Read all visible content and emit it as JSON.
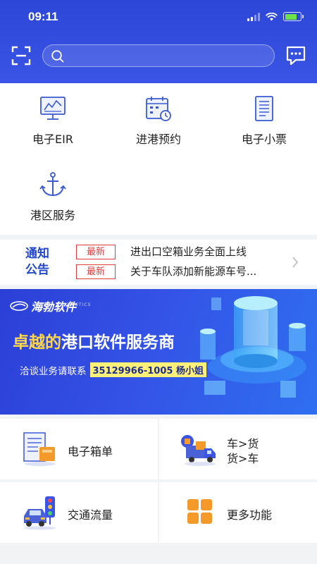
{
  "status_bar": {
    "time": "09:11"
  },
  "search": {
    "placeholder": "",
    "value": ""
  },
  "shortcuts": [
    {
      "label": "电子EIR",
      "icon": "monitor-chart-icon"
    },
    {
      "label": "进港预约",
      "icon": "calendar-clock-icon"
    },
    {
      "label": "电子小票",
      "icon": "receipt-icon"
    },
    {
      "label": "港区服务",
      "icon": "anchor-icon"
    }
  ],
  "notice": {
    "title_line1": "通知",
    "title_line2": "公告",
    "items": [
      {
        "badge": "最新",
        "text": "进出口空箱业务全面上线"
      },
      {
        "badge": "最新",
        "text": "关于车队添加新能源车号..."
      }
    ]
  },
  "banner": {
    "brand": "海勃软件",
    "brand_sub": "HARBOR E-LOGISTICS",
    "slogan_highlight": "卓越的",
    "slogan_rest": "港口软件服务商",
    "contact_prefix": "洽谈业务请联系",
    "contact_phone": "35129966-1005",
    "contact_name": "杨小姐"
  },
  "tiles": [
    {
      "label": "电子箱单",
      "icon": "document-box-icon"
    },
    {
      "label_line1": "车>货",
      "label_line2": "货>车",
      "icon": "truck-cargo-icon"
    },
    {
      "label": "交通流量",
      "icon": "traffic-light-car-icon"
    },
    {
      "label": "更多功能",
      "icon": "grid-more-icon"
    }
  ],
  "colors": {
    "header": "#3a55e6",
    "accent": "#2247c9",
    "badge": "#e53b3b",
    "highlight": "#ffd84a"
  }
}
